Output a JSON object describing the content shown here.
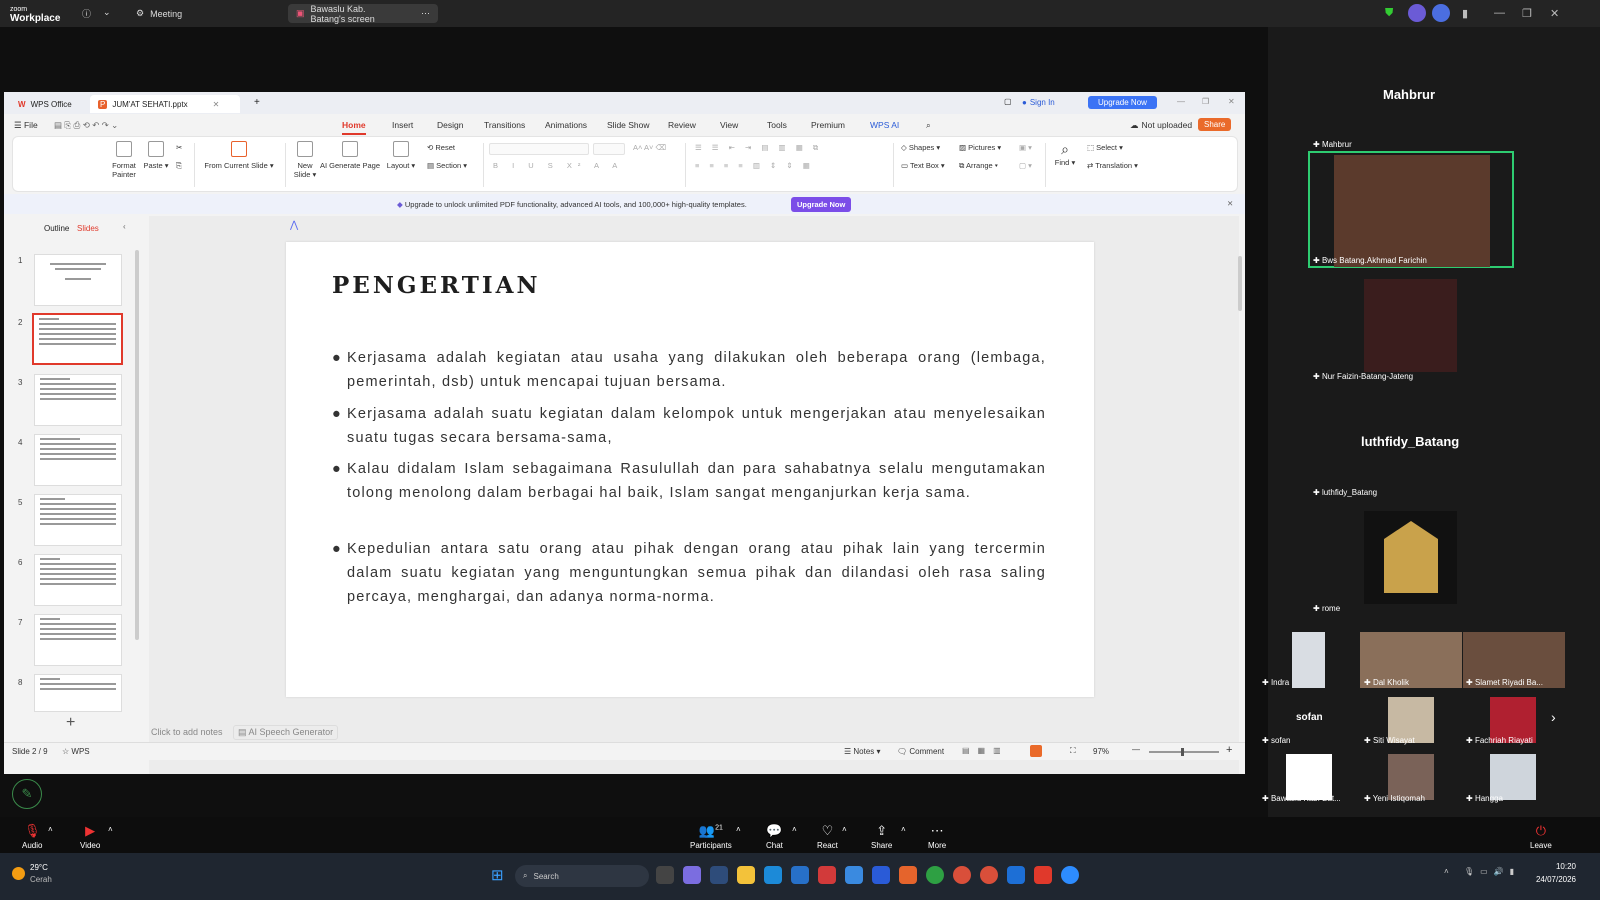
{
  "zoom_top": {
    "logo_line1": "zoom",
    "logo_line2": "Workplace",
    "tab_meeting": "Meeting",
    "tab_share": "Bawaslu Kab. Batang's screen"
  },
  "wps": {
    "app_tab": "WPS Office",
    "doc_tab": "JUM'AT SEHATI.pptx",
    "sign_in": "Sign In",
    "upgrade_now": "Upgrade Now",
    "file_menu": "File",
    "menu": [
      "Home",
      "Insert",
      "Design",
      "Transitions",
      "Animations",
      "Slide Show",
      "Review",
      "View",
      "Tools",
      "Premium",
      "WPS AI"
    ],
    "not_uploaded": "Not uploaded",
    "share": "Share",
    "ribbon": {
      "format_painter": "Format Painter",
      "paste": "Paste",
      "from_current_slide": "From Current Slide",
      "new_slide": "New Slide",
      "ai_generate_page": "AI Generate Page",
      "layout": "Layout",
      "reset": "Reset",
      "section": "Section",
      "shapes": "Shapes",
      "pictures": "Pictures",
      "text_box": "Text Box",
      "arrange": "Arrange",
      "find": "Find",
      "select": "Select",
      "translation": "Translation"
    },
    "banner_text": "Upgrade to unlock unlimited PDF functionality, advanced AI tools, and 100,000+ high-quality templates.",
    "banner_button": "Upgrade Now",
    "panel_tabs": [
      "Outline",
      "Slides"
    ],
    "slide_numbers": [
      "1",
      "2",
      "3",
      "4",
      "5",
      "6",
      "7",
      "8"
    ],
    "notes_placeholder": "Click to add notes",
    "ai_speech": "AI Speech Generator",
    "status": {
      "slide_pos": "Slide 2 / 9",
      "wps": "WPS",
      "notes": "Notes",
      "comment": "Comment",
      "zoom": "97%"
    }
  },
  "slide": {
    "title": "PENGERTIAN",
    "bullets": [
      "Kerjasama adalah kegiatan atau usaha yang dilakukan oleh beberapa orang (lembaga, pemerintah, dsb) untuk mencapai  tujuan bersama.",
      "Kerjasama  adalah  suatu  kegiatan  dalam  kelompok   untuk   mengerjakan   atau menyelesaikan  suatu  tugas  secara  bersama-sama,",
      " Kalau  didalam  Islam  sebagaimana   Rasulullah  dan   para   sahabatnya  selalu mengutamakan tolong menolong dalam berbagai hal baik, Islam sangat menganjurkan kerja sama.",
      "Kepedulian antara satu orang atau pihak dengan orang atau pihak lain yang tercermin dalam suatu kegiatan yang menguntungkan semua pihak dan dilandasi oleh rasa  saling percaya,  menghargai,  dan  adanya norma-norma."
    ]
  },
  "gallery": {
    "header_name": "Mahbrur",
    "p1_top": "Mahbrur",
    "p1_bottom": "Bws Batang.Akhmad Farichin",
    "p2": "Nur Faizin-Batang-Jateng",
    "p3_big": "luthfidy_Batang",
    "p3_small": "luthfidy_Batang",
    "p4": "rome",
    "grid": [
      "Indra",
      "Dal Kholik",
      "Slamet Riyadi Ba...",
      "sofan",
      "Siti Wisayat",
      "Fachriah Riayati",
      "Bawaslu Kab. Bat...",
      "Yeni Istiqomah",
      "Hangga"
    ],
    "sofan_big": "sofan"
  },
  "zoom_controls": {
    "audio": "Audio",
    "video": "Video",
    "participants": "Participants",
    "participants_count": "21",
    "chat": "Chat",
    "react": "React",
    "share": "Share",
    "more": "More",
    "leave": "Leave"
  },
  "taskbar": {
    "temp": "29°C",
    "weather": "Cerah",
    "search": "Search",
    "time": "10:20",
    "date": "24/07/2026"
  }
}
